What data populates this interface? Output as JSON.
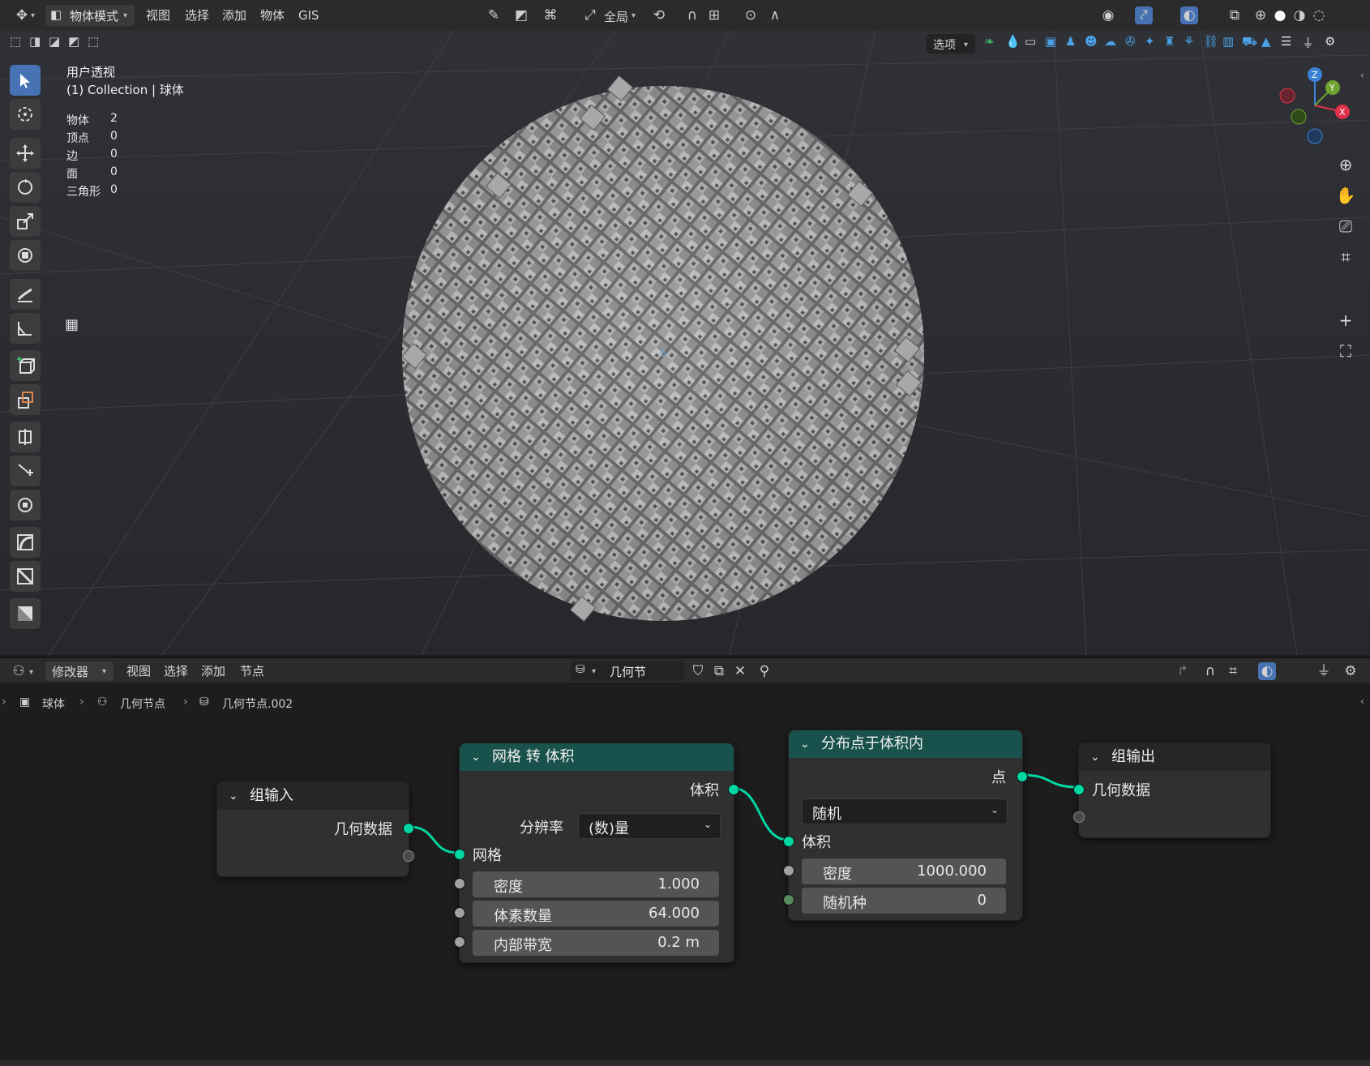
{
  "header": {
    "mode": "物体模式",
    "menus": [
      "视图",
      "选择",
      "添加",
      "物体",
      "GIS"
    ],
    "transform_orientation": "全局",
    "options": "选项"
  },
  "viewport": {
    "view_name": "用户透视",
    "collection_line": "(1) Collection | 球体",
    "stats": [
      {
        "label": "物体",
        "value": "2"
      },
      {
        "label": "顶点",
        "value": "0"
      },
      {
        "label": "边",
        "value": "0"
      },
      {
        "label": "面",
        "value": "0"
      },
      {
        "label": "三角形",
        "value": "0"
      }
    ],
    "gizmo": {
      "x": "X",
      "y": "Y",
      "z": "Z"
    }
  },
  "node_editor": {
    "editor_type": "修改器",
    "menus": [
      "视图",
      "选择",
      "添加",
      "节点"
    ],
    "node_tree_name": "几何节点.002",
    "breadcrumb": [
      "球体",
      "几何节点",
      "几何节点.002"
    ],
    "nodes": {
      "group_input": {
        "title": "组输入",
        "output": "几何数据"
      },
      "mesh_to_volume": {
        "title": "网格 转 体积",
        "output": "体积",
        "resolution_label": "分辨率",
        "resolution_value": "(数)量",
        "input_mesh": "网格",
        "fields": [
          {
            "label": "密度",
            "value": "1.000"
          },
          {
            "label": "体素数量",
            "value": "64.000"
          },
          {
            "label": "内部带宽",
            "value": "0.2 m"
          }
        ]
      },
      "distribute_points": {
        "title": "分布点于体积内",
        "output": "点",
        "mode": "随机",
        "input_volume": "体积",
        "fields": [
          {
            "label": "密度",
            "value": "1000.000"
          },
          {
            "label": "随机种",
            "value": "0"
          }
        ]
      },
      "group_output": {
        "title": "组输出",
        "input": "几何数据"
      }
    }
  },
  "colors": {
    "geometry_socket": "#00d6a3",
    "geometry_header": "#19524c",
    "active_tool": "#4772b3"
  }
}
